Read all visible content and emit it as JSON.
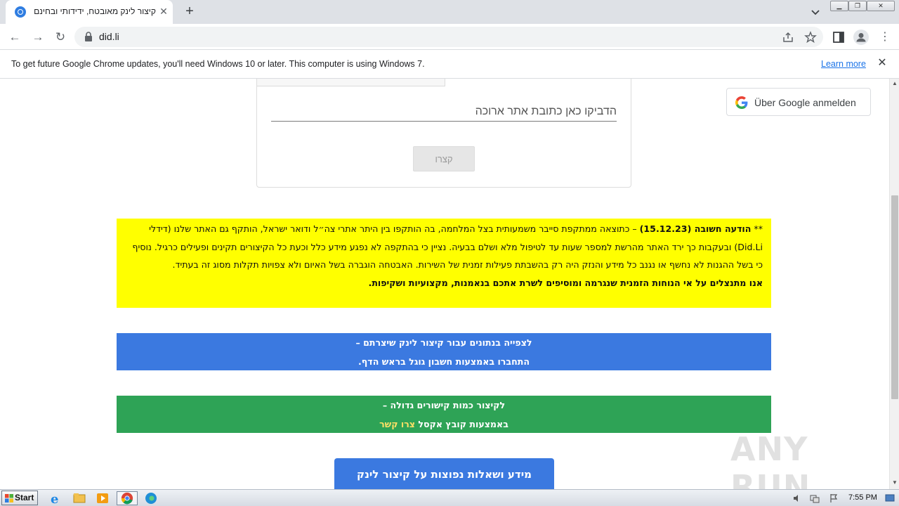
{
  "browser": {
    "tab_title": "קיצור לינק מאובטח, ידידותי ובחינם",
    "url": "did.li",
    "infobar_text": "To get future Google Chrome updates, you'll need Windows 10 or later. This computer is using Windows 7.",
    "infobar_link": "Learn more"
  },
  "form": {
    "url_placeholder": "הדביקו כאן כתובת אתר ארוכה",
    "shorten_button": "קצרו"
  },
  "google_signin": {
    "label": "Über Google anmelden"
  },
  "notice": {
    "prefix": "** ",
    "heading": "הודעה חשובה (15.12.23)",
    "body": " – כתוצאה ממתקפת סייבר משמעותית בצל המלחמה, בה הותקפו בין היתר אתרי צה״ל ודואר ישראל, הותקף גם האתר שלנו (דידלי Did.Li) ובעקבות כך ירד האתר מהרשת למספר שעות עד לטיפול מלא ושלם בבעיה. נציין כי בהתקפה לא נפגע מידע כלל וכעת כל הקיצורים תקינים ופעילים כרגיל. נוסיף כי בשל ההגנות לא נחשף או נגנב כל מידע והנזק היה רק בהשבתת פעילות זמנית של השירות. האבטחה הוגברה בשל האיום ולא צפויות תקלות מסוג זה בעתיד.",
    "closing": "אנו מתנצלים על אי הנוחות הזמנית שנגרמה ומוסיפים לשרת אתכם בנאמנות, מקצועיות ושקיפות."
  },
  "blue_banner": {
    "line1": "לצפייה בנתונים עבור קיצור לינק שיצרתם –",
    "line2": "התחברו באמצעות חשבון גוגל בראש הדף."
  },
  "green_banner": {
    "line1": "לקיצור כמות קישורים גדולה –",
    "line2_prefix": "באמצעות קובץ אקסל ",
    "line2_link": "צרו קשר"
  },
  "faq_button": "מידע ושאלות נפוצות על קיצור לינק",
  "watermark": "ANY RUN",
  "taskbar": {
    "start": "Start",
    "clock": "7:55 PM"
  },
  "colors": {
    "notice_bg": "#ffff00",
    "blue": "#3b79e0",
    "green": "#2ea356",
    "chrome_frame": "#dee1e6"
  }
}
